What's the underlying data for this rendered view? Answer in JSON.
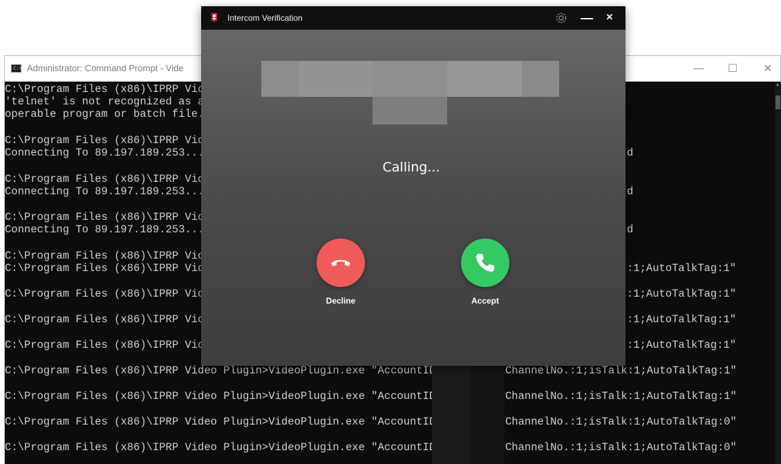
{
  "cmd": {
    "title": "Administrator: Command Prompt - Vide",
    "controls": {
      "minimize": "—",
      "maximize": "☐",
      "close": "✕"
    },
    "lines": [
      "C:\\Program Files (x86)\\IPRP Vic",
      "'telnet' is not recognized as a",
      "operable program or batch file.",
      "C:\\Program Files (x86)\\IPRP Vic",
      "Connecting To 89.197.189.253...",
      "C:\\Program Files (x86)\\IPRP Vic",
      "Connecting To 89.197.189.253...",
      "C:\\Program Files (x86)\\IPRP Vic",
      "Connecting To 89.197.189.253...",
      "C:\\Program Files (x86)\\IPRP Vic",
      "C:\\Program Files (x86)\\IPRP Vic",
      "C:\\Program Files (x86)\\IPRP Vic",
      "C:\\Program Files (x86)\\IPRP Vic",
      "C:\\Program Files (x86)\\IPRP Vic",
      "C:\\Program Files (x86)\\IPRP Video Plugin>VideoPlugin.exe \"AccountID",
      "C:\\Program Files (x86)\\IPRP Video Plugin>VideoPlugin.exe \"AccountID",
      "C:\\Program Files (x86)\\IPRP Video Plugin>VideoPlugin.exe \"AccountID",
      "C:\\Program Files (x86)\\IPRP Video Plugin>VideoPlugin.exe \"AccountID"
    ],
    "right_fragments": [
      "d",
      "d",
      "d",
      ":1;AutoTalkTag:1\"",
      ":1;AutoTalkTag:1\"",
      ":1;AutoTalkTag:1\"",
      ":1;AutoTalkTag:1\"",
      "ChannelNo.:1;isTalk:1;AutoTalkTag:1\"",
      "ChannelNo.:1;isTalk:1;AutoTalkTag:1\"",
      "ChannelNo.:1;isTalk:1;AutoTalkTag:0\"",
      "ChannelNo.:1;isTalk:1;AutoTalkTag:0\""
    ]
  },
  "intercom": {
    "title": "Intercom Verification",
    "minimize": "—",
    "close": "✕",
    "status": "Calling...",
    "decline_label": "Decline",
    "accept_label": "Accept"
  },
  "colors": {
    "decline": "#f05a5a",
    "accept": "#35c964",
    "titlebar": "#0f0f0f",
    "console_bg": "#0c0c0c"
  },
  "icons": {
    "cmd_app": "cmd-icon",
    "intercom_app": "intercom-app-icon",
    "settings": "gear-icon",
    "decline": "phone-hangup-icon",
    "accept": "phone-icon"
  }
}
